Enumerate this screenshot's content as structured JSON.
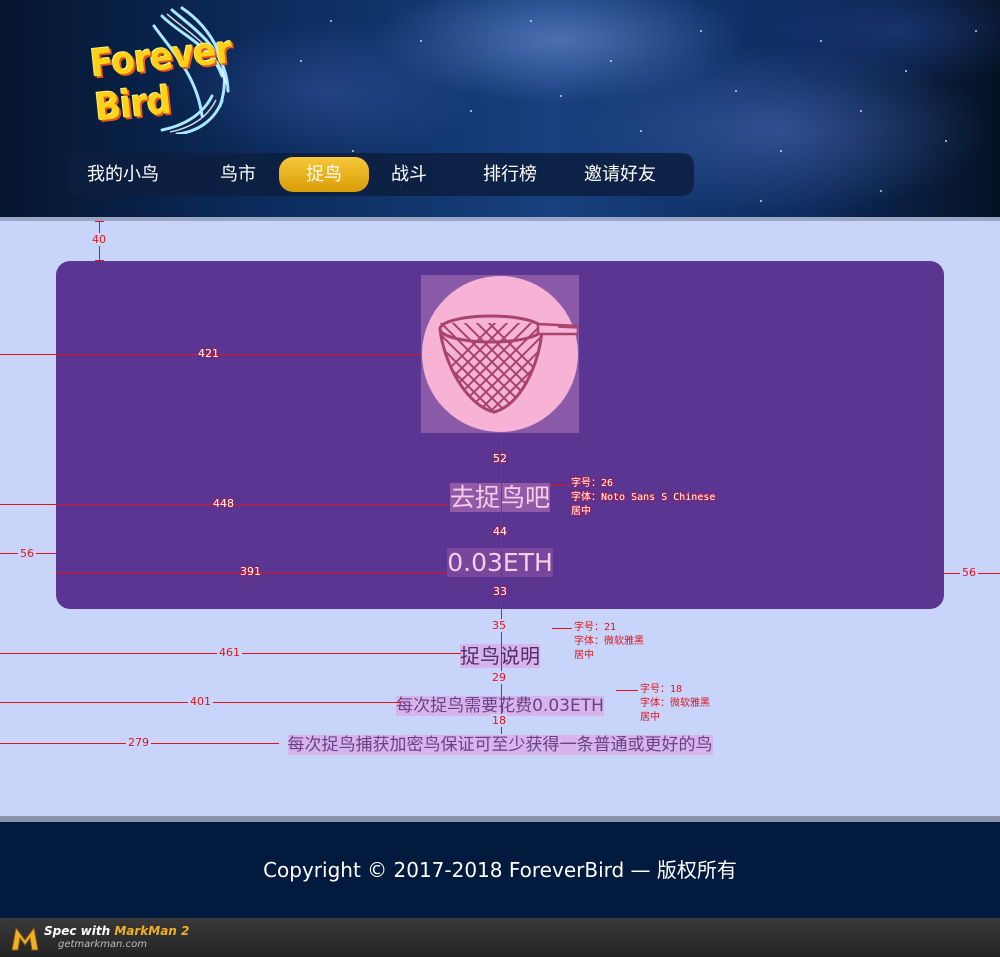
{
  "brand": {
    "logo_text": "Forever Bird"
  },
  "nav": {
    "items": [
      {
        "label": "我的小鸟"
      },
      {
        "label": "鸟市"
      },
      {
        "label": "捉鸟"
      },
      {
        "label": "战斗"
      },
      {
        "label": "排行榜"
      },
      {
        "label": "邀请好友"
      }
    ],
    "active_index": 2
  },
  "catch_card": {
    "icon": "butterfly-net-icon",
    "title": "去捉鸟吧",
    "price": "0.03ETH"
  },
  "description": {
    "title": "捉鸟说明",
    "lines": [
      "每次捉鸟需要花费0.03ETH",
      "每次捉鸟捕获加密鸟保证可至少获得一条普通或更好的鸟"
    ]
  },
  "spec": {
    "measures": {
      "top_gap": "40",
      "icon_left": "421",
      "icon_to_title": "52",
      "title_left": "448",
      "title_to_price": "44",
      "card_left": "56",
      "price_left": "391",
      "price_to_bottom": "33",
      "card_right": "56",
      "card_to_desc": "35",
      "desc_title_left": "461",
      "desc_title_to_line1": "29",
      "line1_left": "401",
      "line1_to_line2": "18",
      "line2_left": "279"
    },
    "notes": {
      "title": [
        "字号：26",
        "字体：Noto Sans S Chinese",
        "居中"
      ],
      "desc_title": [
        "字号：21",
        "字体：微软雅黑",
        "居中"
      ],
      "desc_line": [
        "字号：18",
        "字体：微软雅黑",
        "居中"
      ]
    }
  },
  "footer": {
    "copyright": "Copyright © 2017-2018 ForeverBird — 版权所有"
  },
  "markman": {
    "spec_with": "Spec with",
    "product": "MarkMan 2",
    "url": "getmarkman.com"
  },
  "colors": {
    "card": "#5a3591",
    "page_bg": "#c8d4fa",
    "nav_active": "#e6ad12",
    "footer_bg": "#021a3d",
    "measure": "#e0141e"
  }
}
